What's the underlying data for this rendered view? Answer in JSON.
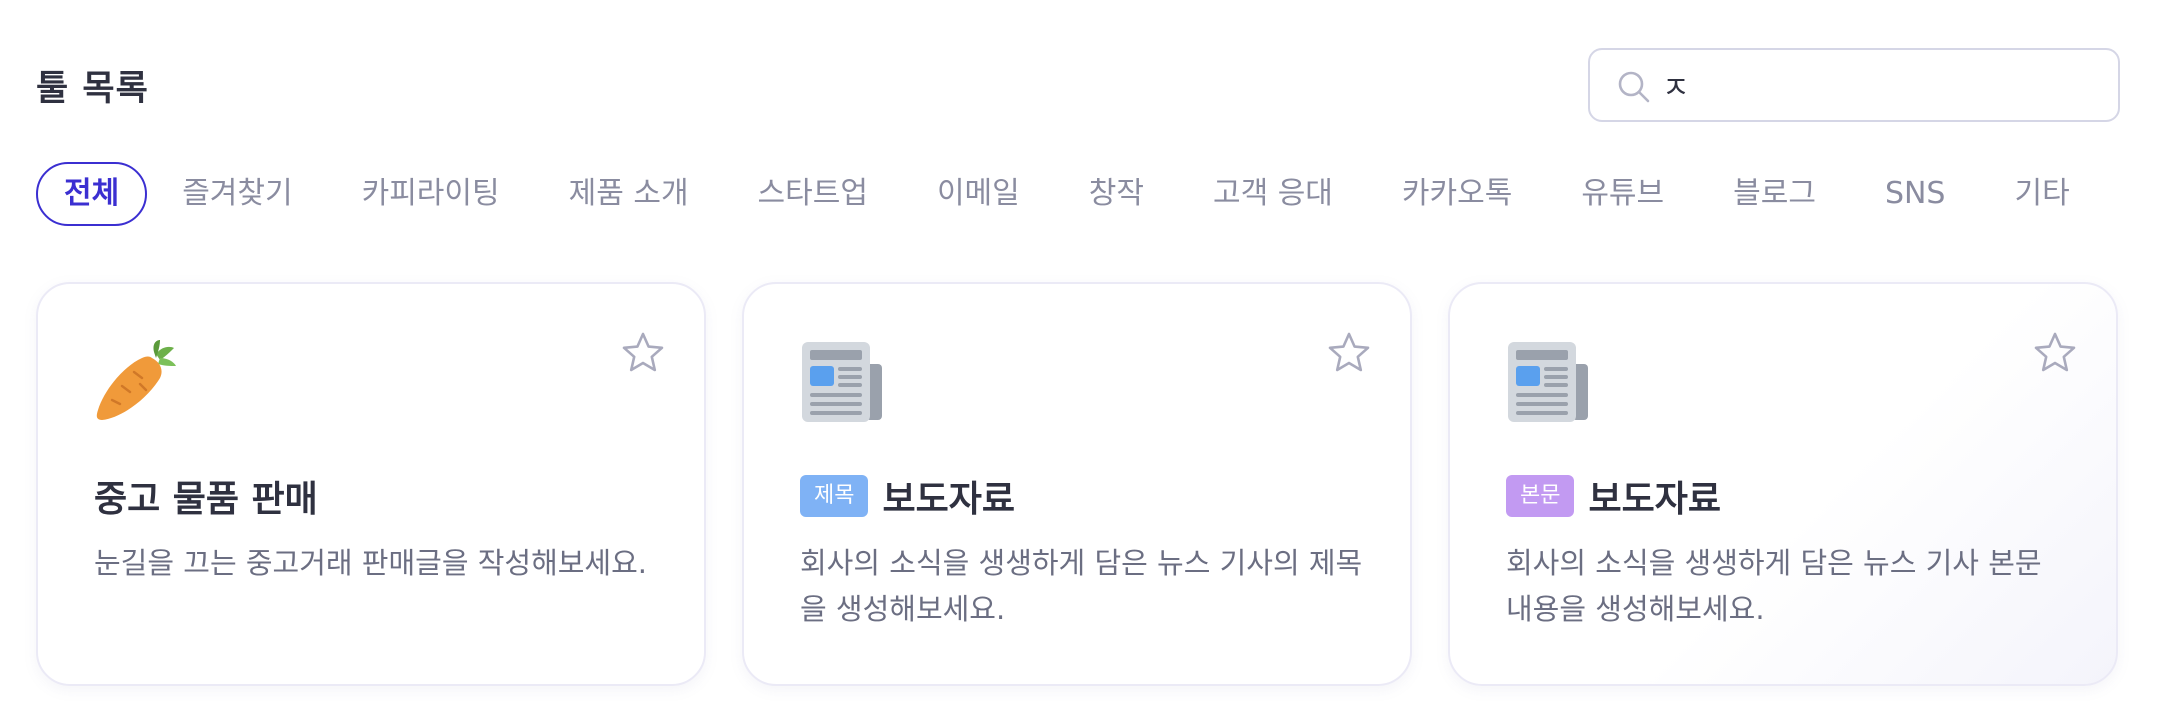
{
  "header": {
    "title": "툴 목록",
    "search": {
      "value": "ㅈ",
      "icon": "search-icon"
    }
  },
  "tabs": [
    {
      "label": "전체",
      "active": true
    },
    {
      "label": "즐겨찾기",
      "active": false
    },
    {
      "label": "카피라이팅",
      "active": false
    },
    {
      "label": "제품 소개",
      "active": false
    },
    {
      "label": "스타트업",
      "active": false
    },
    {
      "label": "이메일",
      "active": false
    },
    {
      "label": "창작",
      "active": false
    },
    {
      "label": "고객 응대",
      "active": false
    },
    {
      "label": "카카오톡",
      "active": false
    },
    {
      "label": "유튜브",
      "active": false
    },
    {
      "label": "블로그",
      "active": false
    },
    {
      "label": "SNS",
      "active": false
    },
    {
      "label": "기타",
      "active": false
    }
  ],
  "cards": [
    {
      "icon": "carrot-icon",
      "badge": "",
      "title": "중고 물품 판매",
      "description": "눈길을 끄는 중고거래 판매글을 작성해보세요."
    },
    {
      "icon": "newspaper-icon",
      "badge": "제목",
      "badge_color": "#7fb2f5",
      "title": "보도자료",
      "description": "회사의 소식을 생생하게 담은 뉴스 기사의 제목을 생성해보세요."
    },
    {
      "icon": "newspaper-icon",
      "badge": "본문",
      "badge_color": "#c29af2",
      "title": "보도자료",
      "description": "회사의 소식을 생생하게 담은 뉴스 기사 본문 내용을 생성해보세요."
    }
  ],
  "colors": {
    "accent": "#3b2fd1",
    "text": "#2f3140",
    "muted": "#8a8ca0"
  }
}
